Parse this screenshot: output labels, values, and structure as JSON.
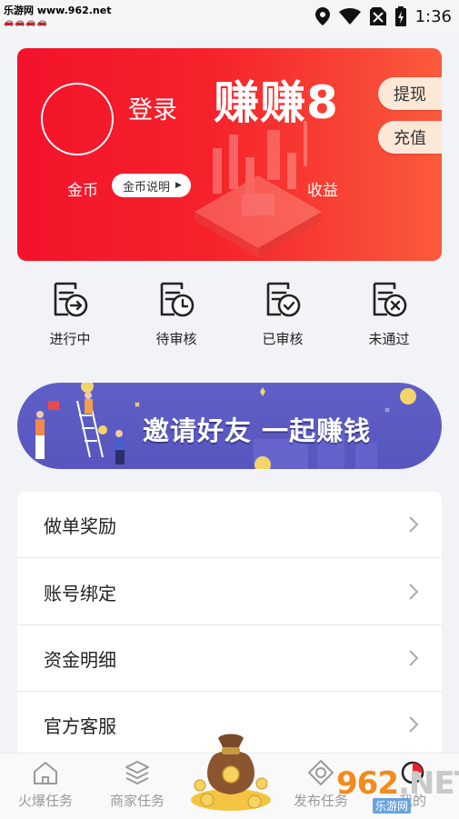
{
  "status_bar": {
    "watermark_site": "乐游网 www.962.net",
    "time": "1:36",
    "icons": [
      "location-icon",
      "wifi-icon",
      "no-sim-icon",
      "battery-charging-icon"
    ]
  },
  "hero": {
    "login": "登录",
    "brand": "赚赚8",
    "withdraw": "提现",
    "recharge": "充值",
    "coin_label": "金币",
    "coin_explain": "金币说明",
    "income_label": "收益",
    "colors": {
      "start": "#f3132b",
      "end": "#fa5a3b",
      "pill": "#fde8d8"
    }
  },
  "task_status": [
    {
      "label": "进行中",
      "icon": "file-arrow-icon"
    },
    {
      "label": "待审核",
      "icon": "file-clock-icon"
    },
    {
      "label": "已审核",
      "icon": "file-check-icon"
    },
    {
      "label": "未通过",
      "icon": "file-cross-icon"
    }
  ],
  "banner": {
    "text": "邀请好友 一起赚钱",
    "color": "#5756be"
  },
  "menu": [
    {
      "label": "做单奖励"
    },
    {
      "label": "账号绑定"
    },
    {
      "label": "资金明细"
    },
    {
      "label": "官方客服"
    }
  ],
  "tabbar": {
    "tabs": [
      {
        "label": "火爆任务",
        "icon": "home-icon"
      },
      {
        "label": "商家任务",
        "icon": "layers-icon"
      },
      {
        "label": "发布任务",
        "icon": "diamond-icon"
      },
      {
        "label": "我的",
        "icon": "profile-icon"
      }
    ],
    "center_icon": "money-bag-icon"
  },
  "overlay_watermark": {
    "big_accent": "962",
    "big_rest": ".NET",
    "small": "乐游网"
  }
}
